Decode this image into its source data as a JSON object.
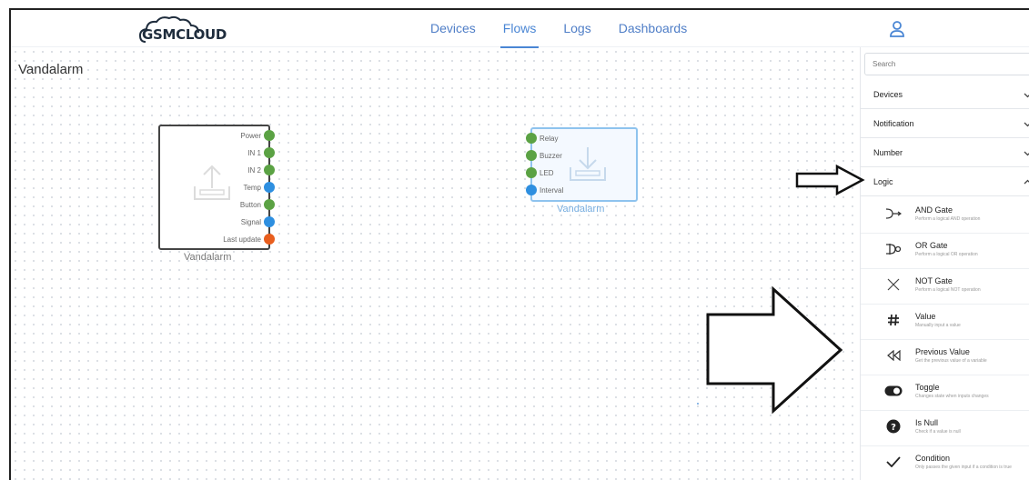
{
  "header": {
    "logo": {
      "part1": "GSM",
      "part2": "CLOUD"
    },
    "nav": [
      {
        "label": "Devices",
        "active": false
      },
      {
        "label": "Flows",
        "active": true
      },
      {
        "label": "Logs",
        "active": false
      },
      {
        "label": "Dashboards",
        "active": false
      }
    ],
    "user_icon": "user-icon"
  },
  "canvas": {
    "flow_title": "Vandalarm",
    "node_a": {
      "caption": "Vandalarm",
      "ports": [
        {
          "label": "Power",
          "color": "green"
        },
        {
          "label": "IN 1",
          "color": "green"
        },
        {
          "label": "IN 2",
          "color": "green"
        },
        {
          "label": "Temp",
          "color": "blue"
        },
        {
          "label": "Button",
          "color": "green"
        },
        {
          "label": "Signal",
          "color": "blue"
        },
        {
          "label": "Last update",
          "color": "orange"
        }
      ]
    },
    "node_b": {
      "caption": "Vandalarm",
      "ports": [
        {
          "label": "Relay",
          "color": "green"
        },
        {
          "label": "Buzzer",
          "color": "green"
        },
        {
          "label": "LED",
          "color": "green"
        },
        {
          "label": "Interval",
          "color": "blue"
        }
      ]
    }
  },
  "sidebar": {
    "search_placeholder": "Search",
    "categories": [
      {
        "label": "Devices",
        "expanded": false
      },
      {
        "label": "Notification",
        "expanded": false
      },
      {
        "label": "Number",
        "expanded": false
      },
      {
        "label": "Logic",
        "expanded": true
      }
    ],
    "logic_items": [
      {
        "name": "AND Gate",
        "desc": "Perform a logical AND operation",
        "icon": "and-gate-icon"
      },
      {
        "name": "OR Gate",
        "desc": "Perform a logical OR operation",
        "icon": "or-gate-icon"
      },
      {
        "name": "NOT Gate",
        "desc": "Perform a logical NOT operation",
        "icon": "not-gate-icon"
      },
      {
        "name": "Value",
        "desc": "Manually input a value",
        "icon": "hash-icon"
      },
      {
        "name": "Previous Value",
        "desc": "Get the previous value of a variable",
        "icon": "rewind-icon"
      },
      {
        "name": "Toggle",
        "desc": "Changes state when inputs changes",
        "icon": "toggle-icon"
      },
      {
        "name": "Is Null",
        "desc": "Check if a value is null",
        "icon": "question-icon"
      },
      {
        "name": "Condition",
        "desc": "Only passes the given input if a condition is true",
        "icon": "check-icon"
      }
    ]
  },
  "colors": {
    "accent": "#4a86d4",
    "port_green": "#5ba244",
    "port_blue": "#2e8fe0",
    "port_orange": "#e85e1e"
  }
}
